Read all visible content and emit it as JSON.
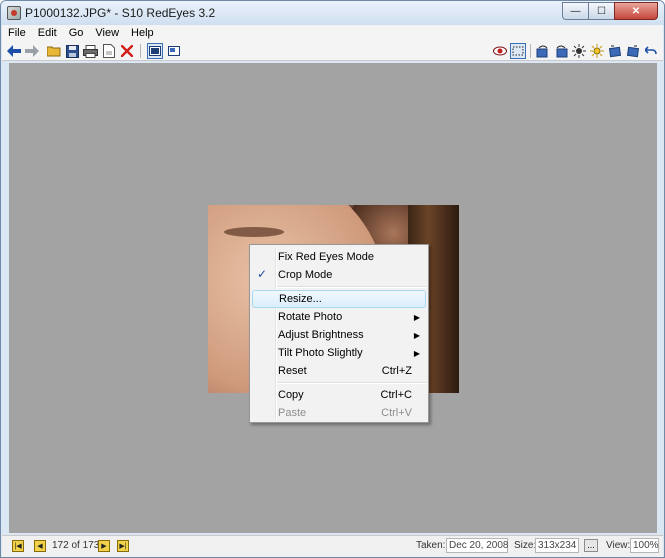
{
  "window": {
    "title": "P1000132.JPG* - S10 RedEyes 3.2",
    "minimize": "—",
    "maximize": "☐",
    "close": "✕"
  },
  "menubar": [
    "File",
    "Edit",
    "Go",
    "View",
    "Help"
  ],
  "toolbar": {
    "back_icon": "arrow-left-icon",
    "forward_icon": "arrow-right-icon",
    "open_icon": "folder-icon",
    "save_icon": "save-icon",
    "print_icon": "print-icon",
    "properties_icon": "document-icon",
    "delete_icon": "delete-icon",
    "colors": {
      "accent": "#3b6fb6",
      "delete": "#d0201a",
      "redeye": "#c82020"
    }
  },
  "context_menu": {
    "items": [
      {
        "label": "Fix Red Eyes Mode",
        "shortcut": "",
        "submenu": false,
        "checked": false,
        "disabled": false,
        "hover": false
      },
      {
        "label": "Crop Mode",
        "shortcut": "",
        "submenu": false,
        "checked": true,
        "disabled": false,
        "hover": false
      },
      {
        "label": "Resize...",
        "shortcut": "",
        "submenu": false,
        "checked": false,
        "disabled": false,
        "hover": true
      },
      {
        "label": "Rotate Photo",
        "shortcut": "",
        "submenu": true,
        "checked": false,
        "disabled": false,
        "hover": false
      },
      {
        "label": "Adjust Brightness",
        "shortcut": "",
        "submenu": true,
        "checked": false,
        "disabled": false,
        "hover": false
      },
      {
        "label": "Tilt Photo Slightly",
        "shortcut": "",
        "submenu": true,
        "checked": false,
        "disabled": false,
        "hover": false
      },
      {
        "label": "Reset",
        "shortcut": "Ctrl+Z",
        "submenu": false,
        "checked": false,
        "disabled": false,
        "hover": false
      },
      {
        "label": "Copy",
        "shortcut": "Ctrl+C",
        "submenu": false,
        "checked": false,
        "disabled": false,
        "hover": false
      },
      {
        "label": "Paste",
        "shortcut": "Ctrl+V",
        "submenu": false,
        "checked": false,
        "disabled": true,
        "hover": false
      }
    ],
    "check_glyph": "✓",
    "arrow_glyph": "▶"
  },
  "statusbar": {
    "page_counter": "172 of 173",
    "taken_label": "Taken:",
    "taken_value": "Dec 20, 2008",
    "size_label": "Size:",
    "size_value": "313x234",
    "more_label": "...",
    "view_label": "View:",
    "view_value": "100%"
  }
}
